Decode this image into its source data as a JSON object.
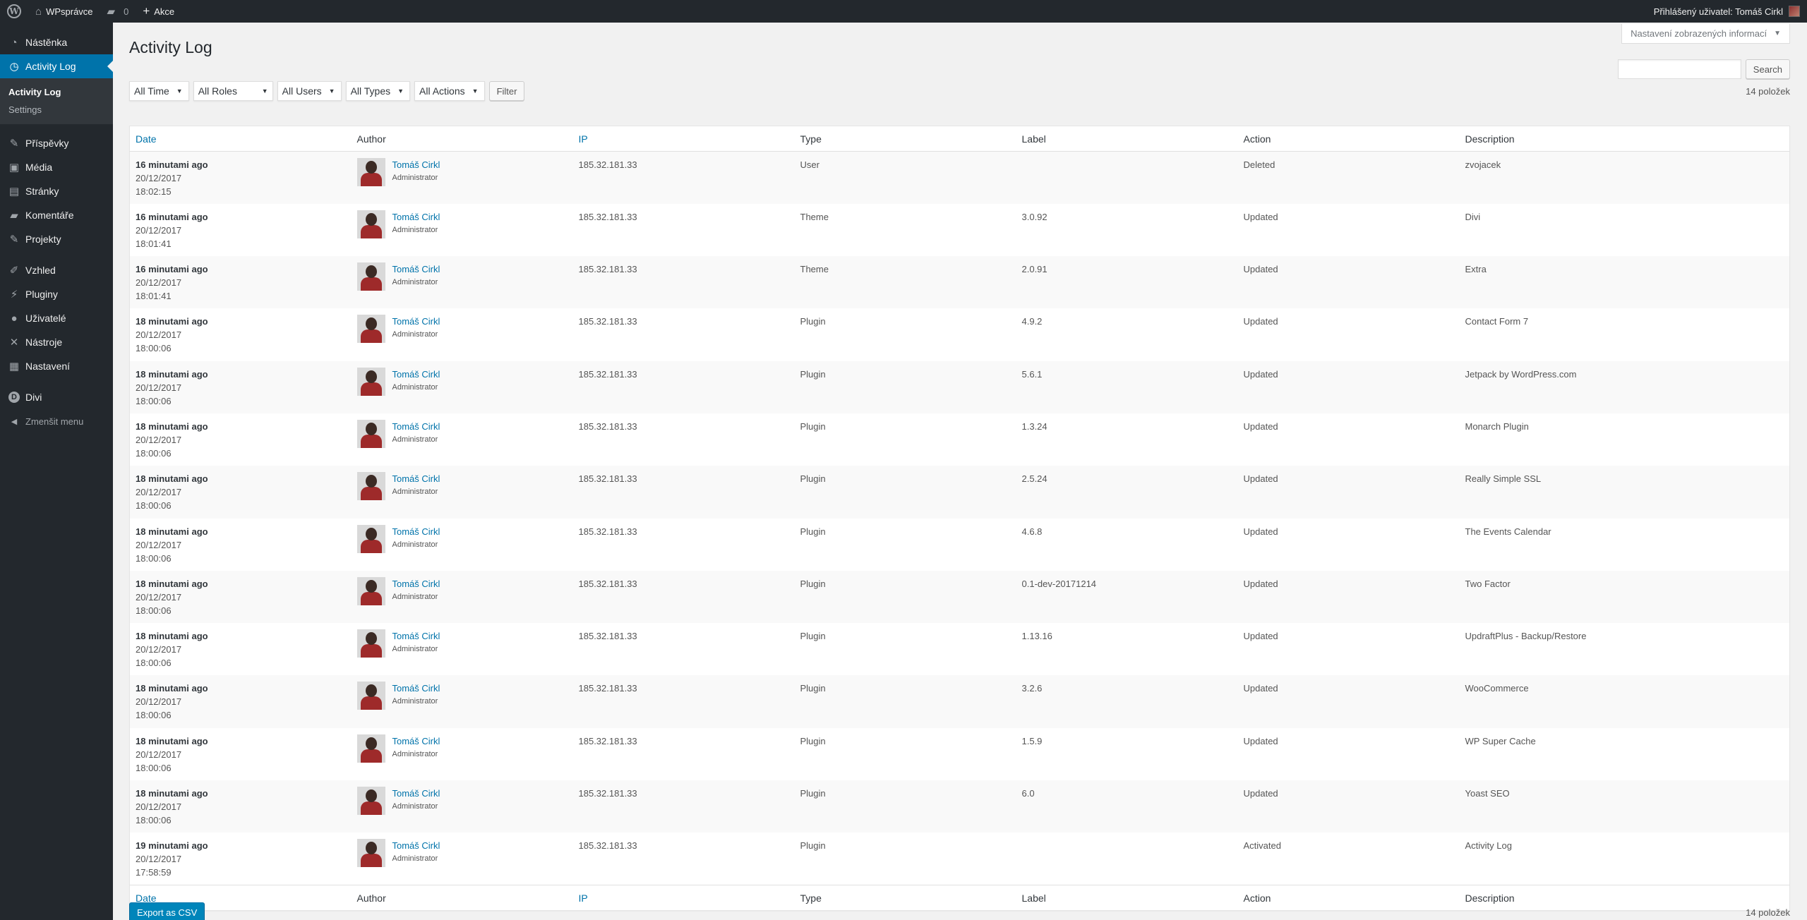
{
  "adminbar": {
    "logo": "W",
    "site_name": "WPsprávce",
    "comments_count": "0",
    "new_label": "Akce",
    "greeting": "Přihlášený uživatel: Tomáš Cirkl",
    "icons": [
      "wordpress-icon",
      "home-icon",
      "comment-icon",
      "plus-icon",
      "avatar"
    ]
  },
  "sidebar": {
    "items": [
      {
        "label": "Nástěnka",
        "icon": "dashboard-icon",
        "glyph": "◔"
      },
      {
        "label": "Activity Log",
        "icon": "clock-icon",
        "glyph": "◷"
      },
      {
        "label": "Příspěvky",
        "icon": "pin-icon",
        "glyph": "✎"
      },
      {
        "label": "Média",
        "icon": "media-icon",
        "glyph": "▣"
      },
      {
        "label": "Stránky",
        "icon": "pages-icon",
        "glyph": "▤"
      },
      {
        "label": "Komentáře",
        "icon": "comments-icon",
        "glyph": "▰"
      },
      {
        "label": "Projekty",
        "icon": "pin-icon",
        "glyph": "✎"
      },
      {
        "label": "Vzhled",
        "icon": "brush-icon",
        "glyph": "✐"
      },
      {
        "label": "Pluginy",
        "icon": "plugin-icon",
        "glyph": "⚡"
      },
      {
        "label": "Uživatelé",
        "icon": "user-icon",
        "glyph": "●"
      },
      {
        "label": "Nástroje",
        "icon": "wrench-icon",
        "glyph": "✕"
      },
      {
        "label": "Nastavení",
        "icon": "settings-icon",
        "glyph": "▦"
      },
      {
        "label": "Divi",
        "icon": "divi-icon",
        "glyph": "D"
      },
      {
        "label": "Zmenšit menu",
        "icon": "collapse-icon",
        "glyph": "◀"
      }
    ],
    "submenu": [
      "Activity Log",
      "Settings"
    ]
  },
  "screen_options": "Nastavení zobrazených informací",
  "page_title": "Activity Log",
  "search": {
    "button": "Search",
    "placeholder": ""
  },
  "filters": [
    "All Time",
    "All Roles",
    "All Users",
    "All Types",
    "All Actions"
  ],
  "filter_button": "Filter",
  "items_count": "14 položek",
  "export_button": "Export as CSV",
  "columns": [
    "Date",
    "Author",
    "IP",
    "Type",
    "Label",
    "Action",
    "Description"
  ],
  "rows": [
    {
      "ago": "16 minutami ago",
      "date": "20/12/2017",
      "time": "18:02:15",
      "author": "Tomáš Cirkl",
      "role": "Administrator",
      "ip": "185.32.181.33",
      "type": "User",
      "label": "",
      "action": "Deleted",
      "description": "zvojacek"
    },
    {
      "ago": "16 minutami ago",
      "date": "20/12/2017",
      "time": "18:01:41",
      "author": "Tomáš Cirkl",
      "role": "Administrator",
      "ip": "185.32.181.33",
      "type": "Theme",
      "label": "3.0.92",
      "action": "Updated",
      "description": "Divi"
    },
    {
      "ago": "16 minutami ago",
      "date": "20/12/2017",
      "time": "18:01:41",
      "author": "Tomáš Cirkl",
      "role": "Administrator",
      "ip": "185.32.181.33",
      "type": "Theme",
      "label": "2.0.91",
      "action": "Updated",
      "description": "Extra"
    },
    {
      "ago": "18 minutami ago",
      "date": "20/12/2017",
      "time": "18:00:06",
      "author": "Tomáš Cirkl",
      "role": "Administrator",
      "ip": "185.32.181.33",
      "type": "Plugin",
      "label": "4.9.2",
      "action": "Updated",
      "description": "Contact Form 7"
    },
    {
      "ago": "18 minutami ago",
      "date": "20/12/2017",
      "time": "18:00:06",
      "author": "Tomáš Cirkl",
      "role": "Administrator",
      "ip": "185.32.181.33",
      "type": "Plugin",
      "label": "5.6.1",
      "action": "Updated",
      "description": "Jetpack by WordPress.com"
    },
    {
      "ago": "18 minutami ago",
      "date": "20/12/2017",
      "time": "18:00:06",
      "author": "Tomáš Cirkl",
      "role": "Administrator",
      "ip": "185.32.181.33",
      "type": "Plugin",
      "label": "1.3.24",
      "action": "Updated",
      "description": "Monarch Plugin"
    },
    {
      "ago": "18 minutami ago",
      "date": "20/12/2017",
      "time": "18:00:06",
      "author": "Tomáš Cirkl",
      "role": "Administrator",
      "ip": "185.32.181.33",
      "type": "Plugin",
      "label": "2.5.24",
      "action": "Updated",
      "description": "Really Simple SSL"
    },
    {
      "ago": "18 minutami ago",
      "date": "20/12/2017",
      "time": "18:00:06",
      "author": "Tomáš Cirkl",
      "role": "Administrator",
      "ip": "185.32.181.33",
      "type": "Plugin",
      "label": "4.6.8",
      "action": "Updated",
      "description": "The Events Calendar"
    },
    {
      "ago": "18 minutami ago",
      "date": "20/12/2017",
      "time": "18:00:06",
      "author": "Tomáš Cirkl",
      "role": "Administrator",
      "ip": "185.32.181.33",
      "type": "Plugin",
      "label": "0.1-dev-20171214",
      "action": "Updated",
      "description": "Two Factor"
    },
    {
      "ago": "18 minutami ago",
      "date": "20/12/2017",
      "time": "18:00:06",
      "author": "Tomáš Cirkl",
      "role": "Administrator",
      "ip": "185.32.181.33",
      "type": "Plugin",
      "label": "1.13.16",
      "action": "Updated",
      "description": "UpdraftPlus - Backup/Restore"
    },
    {
      "ago": "18 minutami ago",
      "date": "20/12/2017",
      "time": "18:00:06",
      "author": "Tomáš Cirkl",
      "role": "Administrator",
      "ip": "185.32.181.33",
      "type": "Plugin",
      "label": "3.2.6",
      "action": "Updated",
      "description": "WooCommerce"
    },
    {
      "ago": "18 minutami ago",
      "date": "20/12/2017",
      "time": "18:00:06",
      "author": "Tomáš Cirkl",
      "role": "Administrator",
      "ip": "185.32.181.33",
      "type": "Plugin",
      "label": "1.5.9",
      "action": "Updated",
      "description": "WP Super Cache"
    },
    {
      "ago": "18 minutami ago",
      "date": "20/12/2017",
      "time": "18:00:06",
      "author": "Tomáš Cirkl",
      "role": "Administrator",
      "ip": "185.32.181.33",
      "type": "Plugin",
      "label": "6.0",
      "action": "Updated",
      "description": "Yoast SEO"
    },
    {
      "ago": "19 minutami ago",
      "date": "20/12/2017",
      "time": "17:58:59",
      "author": "Tomáš Cirkl",
      "role": "Administrator",
      "ip": "185.32.181.33",
      "type": "Plugin",
      "label": "",
      "action": "Activated",
      "description": "Activity Log"
    }
  ],
  "colors": {
    "adminbar_bg": "#23282d",
    "accent": "#0073aa",
    "primary_button": "#0085ba",
    "page_bg": "#f1f1f1"
  }
}
